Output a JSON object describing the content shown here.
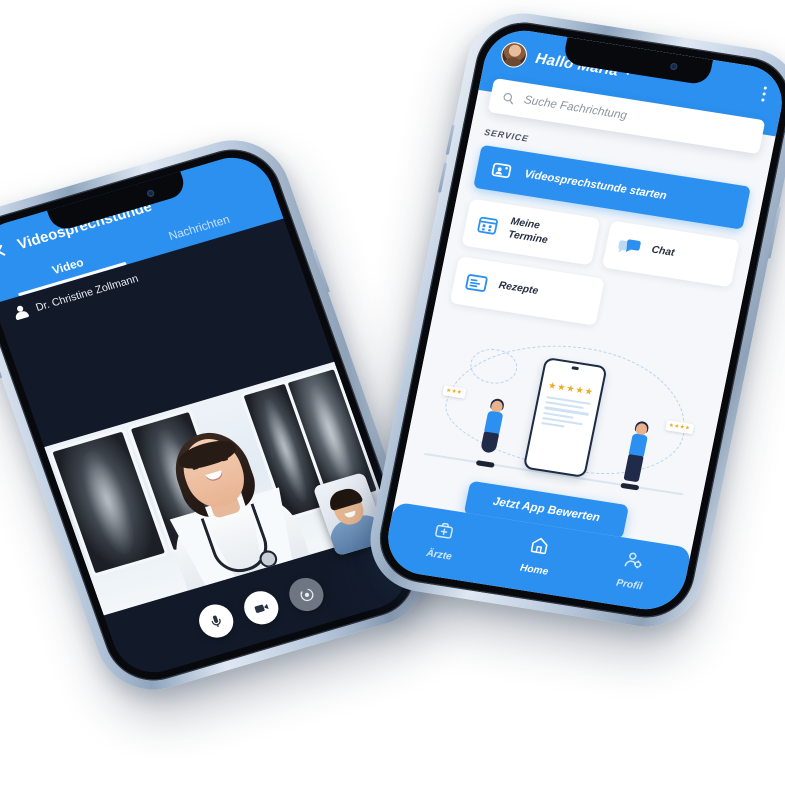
{
  "colors": {
    "brand_blue": "#2b90ef",
    "dark_screen": "#121a2a",
    "page_bg": "#f5f7fa",
    "star_gold": "#f0a91c",
    "frame_silver": "#c3d2e4"
  },
  "video_call_phone": {
    "header": {
      "close_label": "X",
      "title": "Videosprechstunde"
    },
    "tabs": [
      {
        "label": "Video",
        "active": true
      },
      {
        "label": "Nachrichten",
        "active": false
      }
    ],
    "participant": {
      "name": "Dr. Christine Zollmann",
      "icon": "person-icon"
    },
    "remote_video": {
      "description": "Doctor in white coat with stethoscope in front of x-ray lightbox"
    },
    "self_view": {
      "description": "Smiling man in denim shirt"
    },
    "controls": [
      {
        "name": "microphone",
        "icon": "microphone-icon",
        "style": "light"
      },
      {
        "name": "camera",
        "icon": "video-camera-icon",
        "style": "light"
      },
      {
        "name": "switch-camera",
        "icon": "camera-flip-icon",
        "style": "dark"
      }
    ]
  },
  "home_phone": {
    "header": {
      "greeting": "Hallo Maria",
      "avatar": "user-avatar",
      "caret": "chevron-down-icon",
      "menu": "kebab-menu-icon"
    },
    "search": {
      "placeholder": "Suche Fachrichtung",
      "icon": "search-icon"
    },
    "section_label": "SERVICE",
    "primary_action": {
      "label": "Videosprechstunde starten",
      "icon": "video-call-icon"
    },
    "tiles": [
      {
        "label": "Meine\nTermine",
        "label_line1": "Meine",
        "label_line2": "Termine",
        "icon": "calendar-icon"
      },
      {
        "label": "Chat",
        "icon": "chat-bubbles-icon"
      },
      {
        "label": "Rezepte",
        "icon": "prescription-icon"
      }
    ],
    "rating_promo": {
      "stars": 5,
      "stars_glyph": "★★★★★",
      "badge_left": "★★★",
      "badge_right": "★★★★",
      "button_label": "Jetzt App Bewerten"
    },
    "bottom_nav": [
      {
        "label": "Ärzte",
        "icon": "medical-bag-icon",
        "active": false
      },
      {
        "label": "Home",
        "icon": "home-icon",
        "active": true
      },
      {
        "label": "Profil",
        "icon": "user-settings-icon",
        "active": false
      }
    ]
  }
}
